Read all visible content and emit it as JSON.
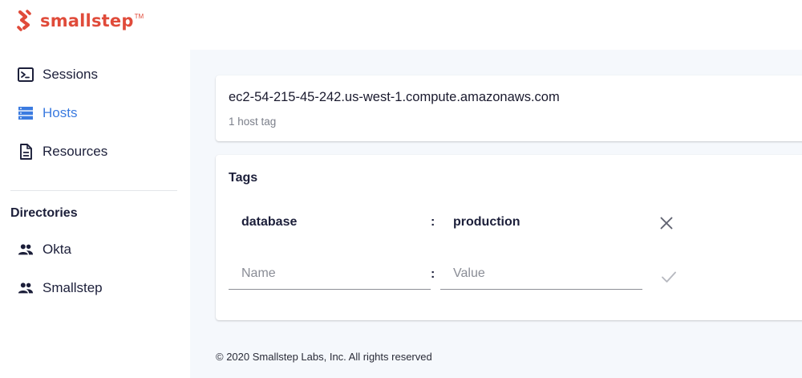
{
  "brand": {
    "name": "smallstep",
    "tm": "TM",
    "color": "#e04b3a"
  },
  "sidebar": {
    "items": [
      {
        "label": "Sessions",
        "icon": "terminal-icon",
        "active": false
      },
      {
        "label": "Hosts",
        "icon": "server-icon",
        "active": true
      },
      {
        "label": "Resources",
        "icon": "document-icon",
        "active": false
      }
    ],
    "directories_title": "Directories",
    "directories": [
      {
        "label": "Okta",
        "icon": "people-icon"
      },
      {
        "label": "Smallstep",
        "icon": "people-icon"
      }
    ],
    "active_color": "#3b7be0"
  },
  "host": {
    "hostname": "ec2-54-215-45-242.us-west-1.compute.amazonaws.com",
    "tag_count": "1 host tag"
  },
  "tags": {
    "title": "Tags",
    "separator": ":",
    "items": [
      {
        "key": "database",
        "value": "production"
      }
    ],
    "new_tag": {
      "name_placeholder": "Name",
      "value_placeholder": "Value",
      "name_value": "",
      "value_value": ""
    }
  },
  "footer": {
    "text": "© 2020 Smallstep Labs, Inc. All rights reserved"
  }
}
